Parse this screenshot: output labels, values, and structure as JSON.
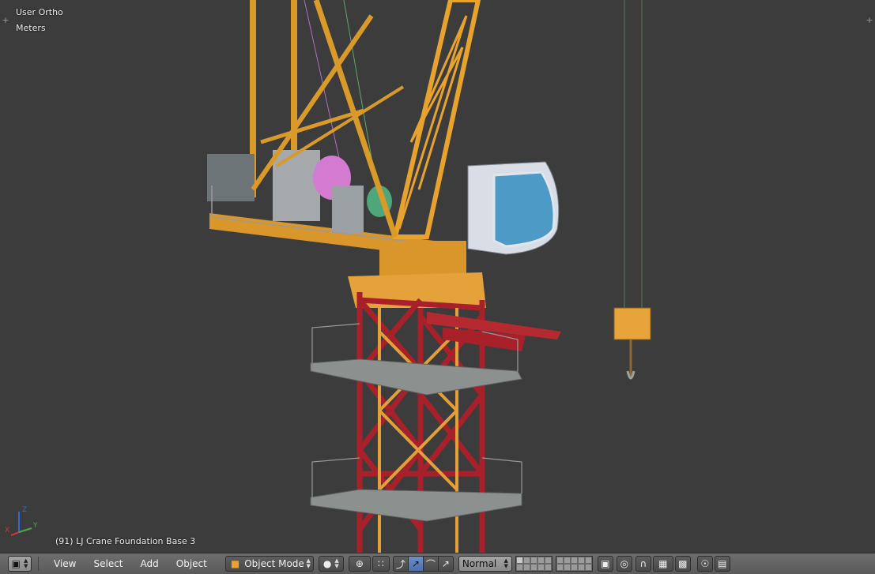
{
  "viewport": {
    "view_label": "User Ortho",
    "units_label": "Meters",
    "object_info": "(91) LJ Crane Foundation Base 3",
    "axis_z": "Z",
    "axis_y": "Y",
    "axis_x": "X"
  },
  "header": {
    "menu": [
      "View",
      "Select",
      "Add",
      "Object"
    ],
    "mode_label": "Object Mode",
    "orientation_label": "Normal"
  },
  "colors": {
    "viewport_bg": "#3c3c3c",
    "crane_yellow": "#e8a32e",
    "tower_red": "#a8202a",
    "header_bg": "#666666"
  },
  "icons": {
    "editor_type": "3d-view-cube-icon",
    "viewport_shading": "solid-sphere-icon",
    "pivot": "pivot-point-icon",
    "manipulator": "transform-manipulator-icon"
  }
}
